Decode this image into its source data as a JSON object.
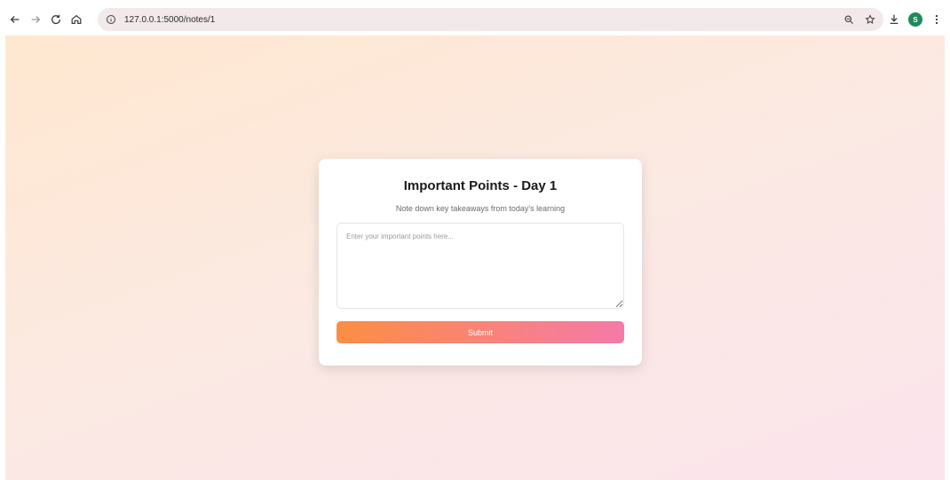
{
  "browser": {
    "url": "127.0.0.1:5000/notes/1",
    "avatar_letter": "S",
    "avatar_color": "#1f8a5a",
    "icons": {
      "back": "arrow-left-icon",
      "forward": "arrow-right-icon",
      "reload": "reload-icon",
      "home": "home-icon",
      "site_info": "info-icon",
      "zoom": "zoom-icon",
      "bookmark": "star-icon",
      "download": "download-icon",
      "menu": "kebab-menu-icon"
    }
  },
  "page": {
    "title": "Important Points - Day 1",
    "subtitle": "Note down key takeaways from today's learning",
    "textarea": {
      "value": "",
      "placeholder": "Enter your important points here..."
    },
    "submit_label": "Submit",
    "colors": {
      "button_start": "#fb8e44",
      "button_end": "#f47aa9",
      "background_start": "#ffe8d0",
      "background_end": "#fbe4ec"
    }
  }
}
